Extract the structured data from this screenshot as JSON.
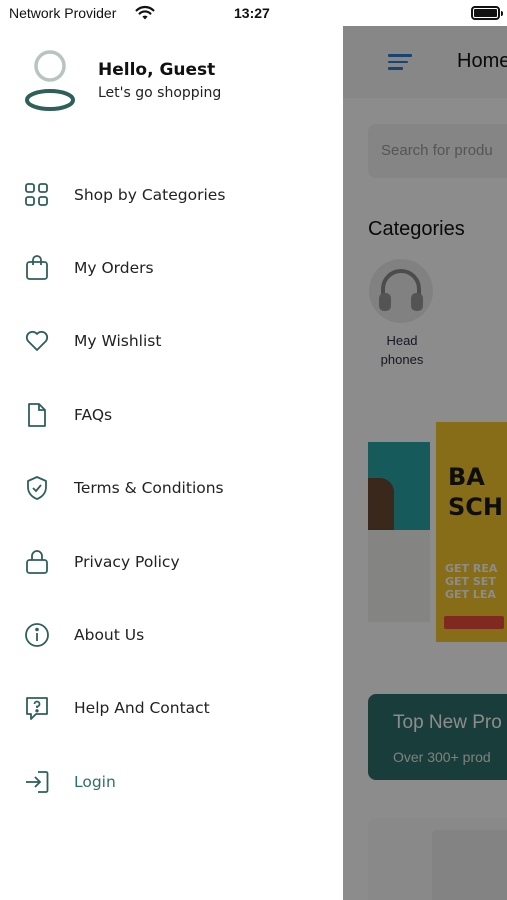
{
  "status_bar": {
    "carrier": "Network Provider",
    "time": "13:27",
    "wifi_icon": "wifi-icon",
    "battery_icon": "battery-icon"
  },
  "theme": {
    "accent": "#2f6f6a",
    "icon_color": "#2f5f5a",
    "overlay": "#000000"
  },
  "drawer": {
    "greeting": "Hello, Guest",
    "subtitle": "Let's go shopping",
    "items": [
      {
        "label": "Shop by Categories",
        "icon": "grid-icon"
      },
      {
        "label": "My Orders",
        "icon": "shopping-bag-icon"
      },
      {
        "label": "My Wishlist",
        "icon": "heart-icon"
      },
      {
        "label": "FAQs",
        "icon": "document-icon"
      },
      {
        "label": "Terms & Conditions",
        "icon": "shield-check-icon"
      },
      {
        "label": "Privacy Policy",
        "icon": "lock-icon"
      },
      {
        "label": "About Us",
        "icon": "info-icon"
      },
      {
        "label": "Help And Contact",
        "icon": "help-chat-icon"
      },
      {
        "label": "Login",
        "icon": "login-icon"
      }
    ]
  },
  "background": {
    "header_title": "Home",
    "search_placeholder": "Search for produ",
    "categories_title": "Categories",
    "category": {
      "label": "Head phones"
    },
    "banner_headline": "BA SCH",
    "banner_line": "GET REA GET SET GET LEA",
    "promo_title": "Top New Pro",
    "promo_subtitle": "Over 300+ prod"
  }
}
